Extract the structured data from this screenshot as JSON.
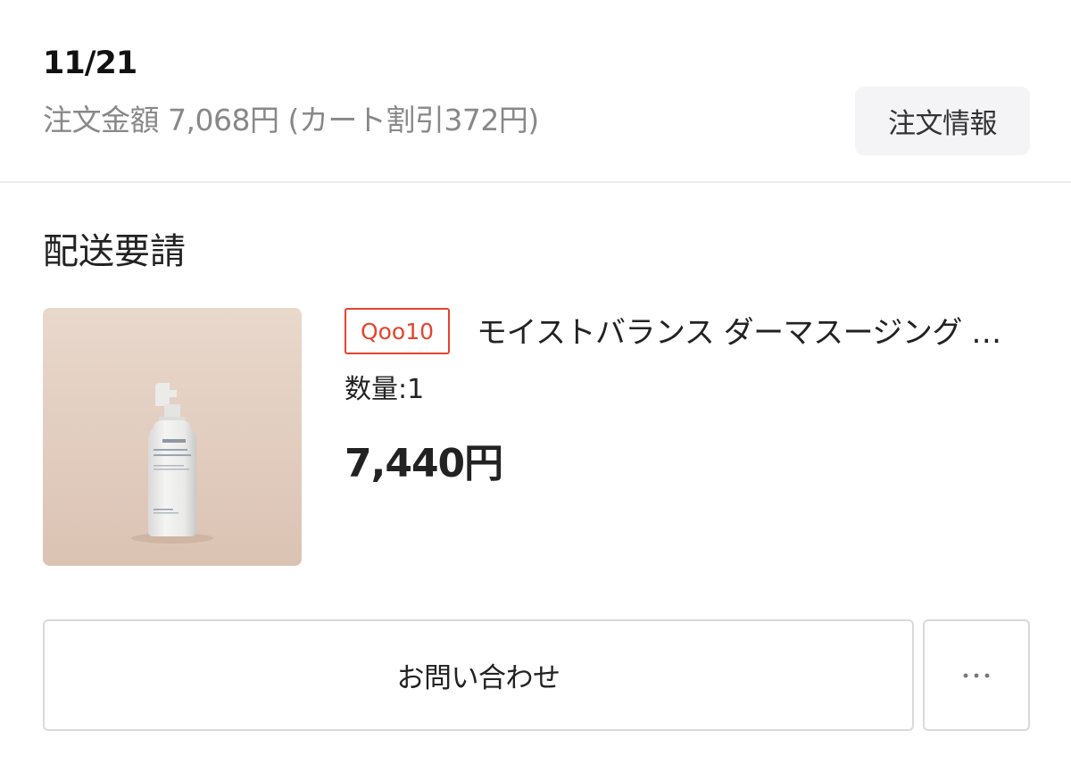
{
  "order": {
    "date": "11/21",
    "amount_text": "注文金額 7,068円 (カート割引372円)",
    "info_button_label": "注文情報"
  },
  "shipment": {
    "status_title": "配送要請"
  },
  "product": {
    "image_icon": "product-bottle-image",
    "image_brand_text": "FLEXKIN",
    "store_badge": "Qoo10",
    "name": "モイストバランス ダーマスージング トナー",
    "quantity_text": "数量:1",
    "price_text": "7,440円"
  },
  "actions": {
    "contact_label": "お問い合わせ",
    "more_icon": "more-horizontal-icon"
  },
  "colors": {
    "badge_red": "#e5432e",
    "muted_text": "#888888",
    "button_bg": "#f4f4f7",
    "border": "#d9d9de"
  }
}
